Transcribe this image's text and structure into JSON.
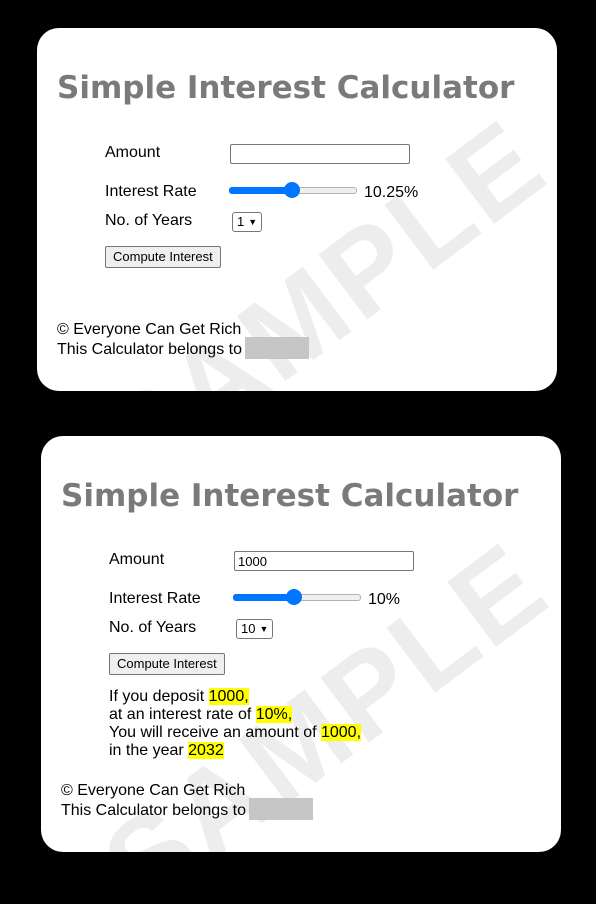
{
  "watermark": "SAMPLE",
  "calculators": [
    {
      "title": "Simple Interest Calculator",
      "labels": {
        "amount": "Amount",
        "rate": "Interest Rate",
        "years": "No. of Years"
      },
      "amount_value": "",
      "rate_percent": 10.25,
      "rate_display": "10.25%",
      "slider_fraction": 0.49,
      "years_selected": "1",
      "button_label": "Compute Interest",
      "footer": {
        "copyright": "© Everyone Can Get Rich",
        "owner_prefix": "This Calculator belongs to"
      }
    },
    {
      "title": "Simple Interest Calculator",
      "labels": {
        "amount": "Amount",
        "rate": "Interest Rate",
        "years": "No. of Years"
      },
      "amount_value": "1000",
      "rate_percent": 10,
      "rate_display": "10%",
      "slider_fraction": 0.48,
      "years_selected": "10",
      "button_label": "Compute Interest",
      "result": {
        "line1_prefix": "If you deposit ",
        "line1_value": "1000,",
        "line2_prefix": "at an interest rate of ",
        "line2_value": "10%,",
        "line3_prefix": "You will receive an amount of ",
        "line3_value": "1000,",
        "line4_prefix": "in the year ",
        "line4_value": "2032"
      },
      "footer": {
        "copyright": "© Everyone Can Get Rich",
        "owner_prefix": "This Calculator belongs to"
      }
    }
  ],
  "colors": {
    "accent": "#0075ff",
    "highlight": "#ffff00",
    "title": "#7a7a7a",
    "background": "#000000"
  }
}
